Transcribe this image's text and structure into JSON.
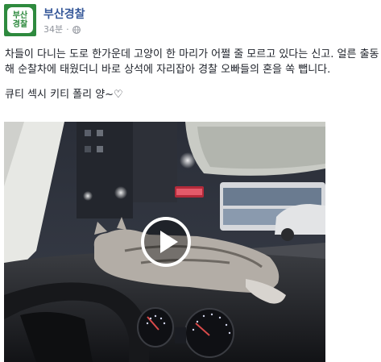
{
  "page": {
    "name": "부산경찰",
    "avatar_line1": "부산",
    "avatar_line2": "경찰",
    "timestamp": "34분",
    "privacy_icon": "globe-icon"
  },
  "post": {
    "paragraph1": "차들이 다니는 도로 한가운데 고양이 한 마리가 어쩔 줄 모르고 있다는 신고. 얼른 출동해 순찰차에 태웠더니 바로 상석에 자리잡아 경찰 오빠들의 혼을 쏙 뺍니다.",
    "paragraph2": "큐티 섹시 키티 폴리 양~♡"
  },
  "video": {
    "play_icon": "play-icon"
  },
  "colors": {
    "link": "#365899",
    "meta": "#90949c",
    "brand": "#2e8a3e"
  }
}
